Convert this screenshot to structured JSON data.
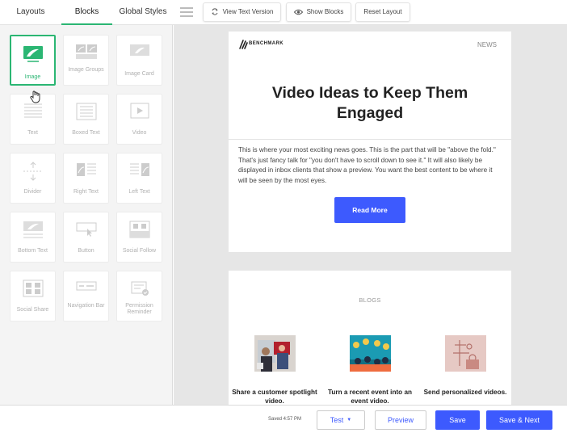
{
  "tabs": [
    {
      "label": "Layouts"
    },
    {
      "label": "Blocks"
    },
    {
      "label": "Global Styles"
    }
  ],
  "toolbar": {
    "text_version": "View Text Version",
    "show_blocks": "Show Blocks",
    "reset_layout": "Reset Layout"
  },
  "blocks": [
    {
      "label": "Image",
      "icon": "image-icon",
      "selected": true
    },
    {
      "label": "Image Groups",
      "icon": "image-groups-icon"
    },
    {
      "label": "Image Card",
      "icon": "image-card-icon"
    },
    {
      "label": "Text",
      "icon": "text-icon"
    },
    {
      "label": "Boxed Text",
      "icon": "boxed-text-icon"
    },
    {
      "label": "Video",
      "icon": "video-icon"
    },
    {
      "label": "Divider",
      "icon": "divider-icon"
    },
    {
      "label": "Right Text",
      "icon": "right-text-icon"
    },
    {
      "label": "Left Text",
      "icon": "left-text-icon"
    },
    {
      "label": "Bottom Text",
      "icon": "bottom-text-icon"
    },
    {
      "label": "Button",
      "icon": "button-icon"
    },
    {
      "label": "Social Follow",
      "icon": "social-follow-icon"
    },
    {
      "label": "Social Share",
      "icon": "social-share-icon"
    },
    {
      "label": "Navigation Bar",
      "icon": "navigation-bar-icon"
    },
    {
      "label": "Permission Reminder",
      "icon": "permission-reminder-icon"
    }
  ],
  "email": {
    "logo_text": "BENCHMARK",
    "news_label": "NEWS",
    "headline": "Video Ideas to Keep Them Engaged",
    "body": "This is where your most exciting news goes. This is the part that will be \"above the fold.\" That's just fancy talk for \"you don't have to scroll down to see it.\" It will also likely be displayed in inbox clients that show a preview. You want the best content to be where it will be seen by the most eyes.",
    "button_label": "Read More",
    "blogs_label": "BLOGS",
    "blogs": [
      {
        "title": "Share a customer spotlight video."
      },
      {
        "title": "Turn a recent event into an event video."
      },
      {
        "title": "Send personalized videos."
      }
    ]
  },
  "footer": {
    "saved": "Saved 4:57 PM",
    "test": "Test",
    "preview": "Preview",
    "save": "Save",
    "save_next": "Save & Next"
  },
  "colors": {
    "accent_green": "#2bb673",
    "primary_blue": "#3d5afe"
  }
}
